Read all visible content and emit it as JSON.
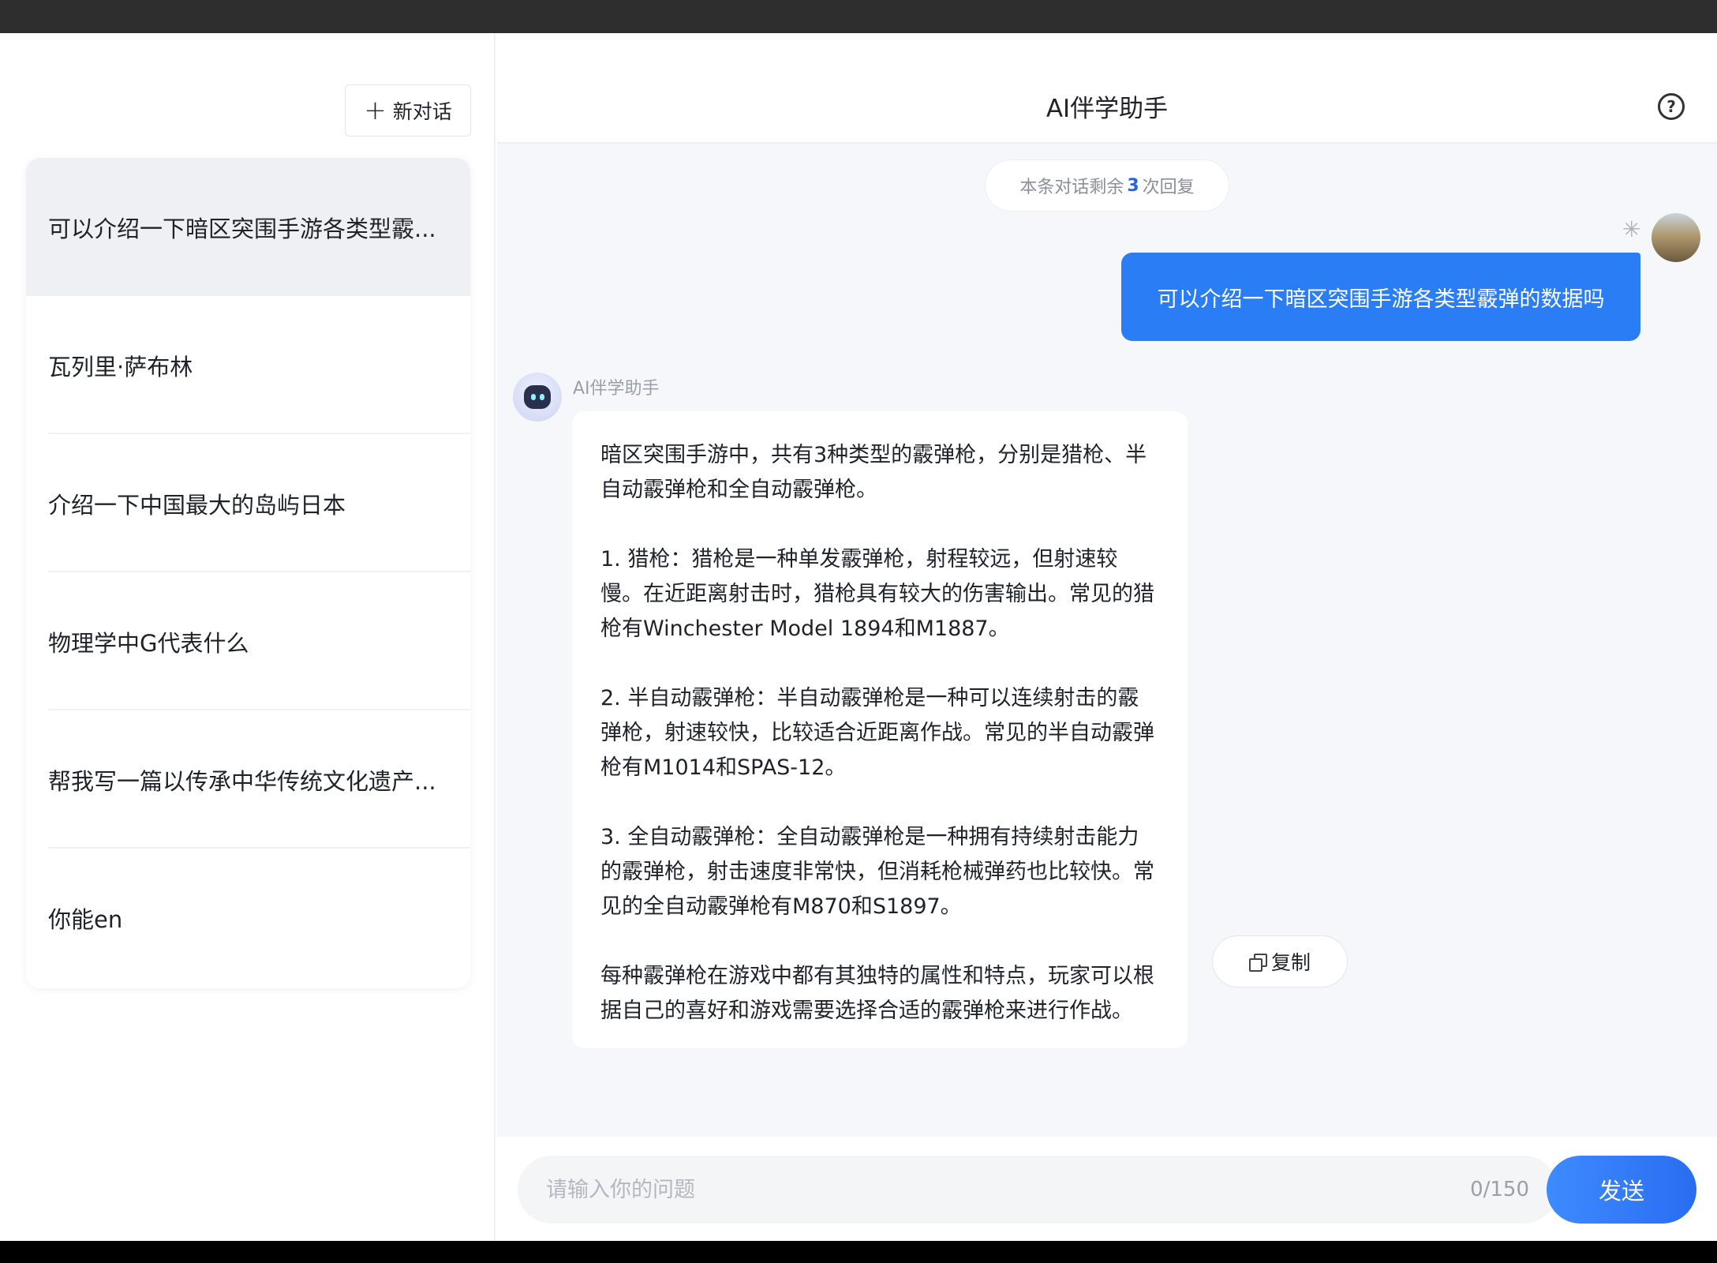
{
  "sidebar": {
    "new_chat_label": "新对话",
    "conversations": [
      {
        "title": "可以介绍一下暗区突围手游各类型霰..."
      },
      {
        "title": "瓦列里·萨布林"
      },
      {
        "title": "介绍一下中国最大的岛屿日本"
      },
      {
        "title": "物理学中G代表什么"
      },
      {
        "title": "帮我写一篇以传承中华传统文化遗产..."
      },
      {
        "title": "你能en"
      }
    ]
  },
  "header": {
    "title": "AI伴学助手",
    "help_icon": "question-circle-icon"
  },
  "remaining": {
    "prefix": "本条对话剩余",
    "count": "3",
    "suffix": "次回复"
  },
  "user_message": {
    "text": "可以介绍一下暗区突围手游各类型霰弹的数据吗"
  },
  "bot": {
    "name": "AI伴学助手",
    "paragraphs": [
      "暗区突围手游中，共有3种类型的霰弹枪，分别是猎枪、半自动霰弹枪和全自动霰弹枪。",
      "1. 猎枪：猎枪是一种单发霰弹枪，射程较远，但射速较慢。在近距离射击时，猎枪具有较大的伤害输出。常见的猎枪有Winchester Model 1894和M1887。",
      "2. 半自动霰弹枪：半自动霰弹枪是一种可以连续射击的霰弹枪，射速较快，比较适合近距离作战。常见的半自动霰弹枪有M1014和SPAS-12。",
      "3. 全自动霰弹枪：全自动霰弹枪是一种拥有持续射击能力的霰弹枪，射击速度非常快，但消耗枪械弹药也比较快。常见的全自动霰弹枪有M870和S1897。",
      "每种霰弹枪在游戏中都有其独特的属性和特点，玩家可以根据自己的喜好和游戏需要选择合适的霰弹枪来进行作战。"
    ],
    "copy_label": "复制"
  },
  "input": {
    "placeholder": "请输入你的问题",
    "value": "",
    "counter": "0/150",
    "send_label": "发送"
  }
}
